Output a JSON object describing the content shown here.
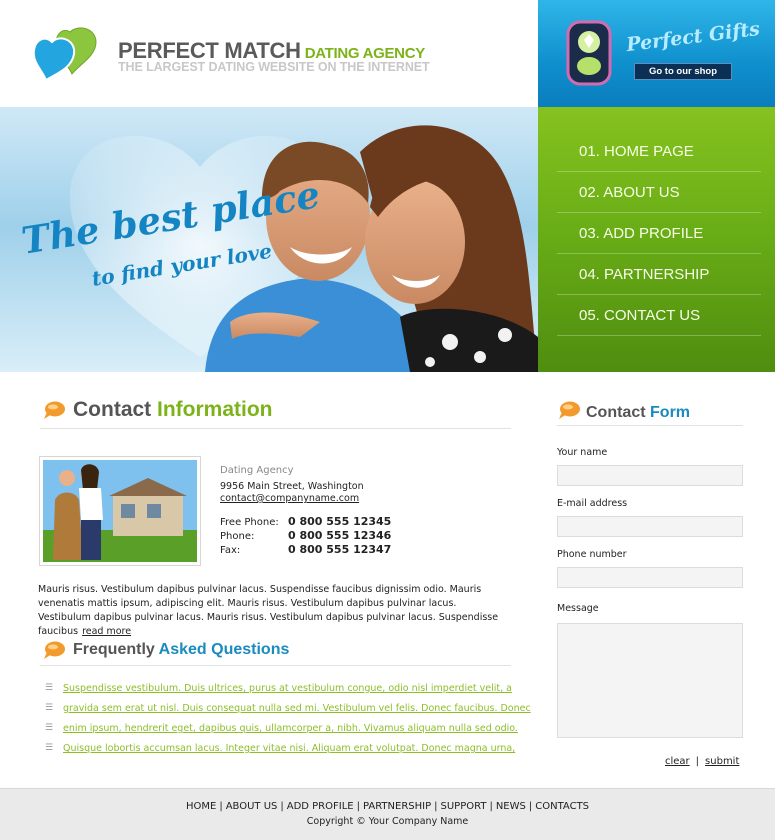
{
  "header": {
    "brand": "PERFECT MATCH",
    "brand_sub": "DATING AGENCY",
    "tagline": "THE LARGEST DATING WEBSITE ON THE INTERNET"
  },
  "gifts": {
    "title": "Perfect Gifts",
    "button": "Go to our shop"
  },
  "hero": {
    "line1": "The best place",
    "line2": "to find your love"
  },
  "nav": {
    "items": [
      {
        "label": "01. HOME PAGE"
      },
      {
        "label": "02. ABOUT US"
      },
      {
        "label": "03. ADD PROFILE"
      },
      {
        "label": "04. PARTNERSHIP"
      },
      {
        "label": "05. CONTACT US"
      }
    ]
  },
  "contact_info": {
    "title_a": "Contact",
    "title_b": "Information",
    "agency": "Dating Agency",
    "street": "9956 Main Street, Washington",
    "email": "contact@companyname.com",
    "phones": [
      {
        "label": "Free Phone:",
        "number": "0 800 555 12345"
      },
      {
        "label": "Phone:",
        "number": "0 800 555 12346"
      },
      {
        "label": "Fax:",
        "number": "0 800 555 12347"
      }
    ],
    "body": "Mauris risus. Vestibulum dapibus pulvinar lacus. Suspendisse faucibus dignissim odio. Mauris venenatis mattis ipsum, adipiscing elit. Mauris risus. Vestibulum dapibus pulvinar lacus. Vestibulum dapibus pulvinar lacus. Mauris risus. Vestibulum dapibus pulvinar lacus. Suspendisse faucibus",
    "read_more": "read more"
  },
  "faq": {
    "title_a": "Frequently",
    "title_b": "Asked Questions",
    "items": [
      {
        "text": "Suspendisse vestibulum. Duis ultrices, purus at vestibulum congue, odio nisl imperdiet velit, a"
      },
      {
        "text": "gravida sem erat ut nisl. Duis consequat nulla sed mi. Vestibulum vel felis. Donec faucibus. Donec"
      },
      {
        "text": "enim ipsum, hendrerit eget, dapibus quis, ullamcorper a, nibh. Vivamus aliquam nulla sed odio."
      },
      {
        "text": "Quisque lobortis accumsan lacus. Integer vitae nisi. Aliquam erat volutpat. Donec magna urna,"
      }
    ]
  },
  "contact_form": {
    "title_a": "Contact",
    "title_b": "Form",
    "name_label": "Your name",
    "name_value": "",
    "email_label": "E-mail address",
    "email_value": "",
    "phone_label": "Phone number",
    "phone_value": "",
    "message_label": "Message",
    "message_value": "",
    "clear": "clear",
    "separator": "|",
    "submit": "submit"
  },
  "footer": {
    "links": [
      {
        "label": "HOME"
      },
      {
        "label": "ABOUT US"
      },
      {
        "label": "ADD PROFILE"
      },
      {
        "label": "PARTNERSHIP"
      },
      {
        "label": "SUPPORT"
      },
      {
        "label": "NEWS"
      },
      {
        "label": "CONTACTS"
      }
    ],
    "separator": "|",
    "copyright": "Copyright © Your Company Name"
  },
  "colors": {
    "accent_green": "#7db31a",
    "accent_blue": "#1a8bbf",
    "nav_green": "#6aae17",
    "header_blue": "#0f8fcd"
  },
  "icons": {
    "logo": "two-hearts-icon",
    "gift": "gift-box-icon",
    "section": "speech-bubble-icon",
    "faq_bullet": "list-bullet-icon"
  }
}
